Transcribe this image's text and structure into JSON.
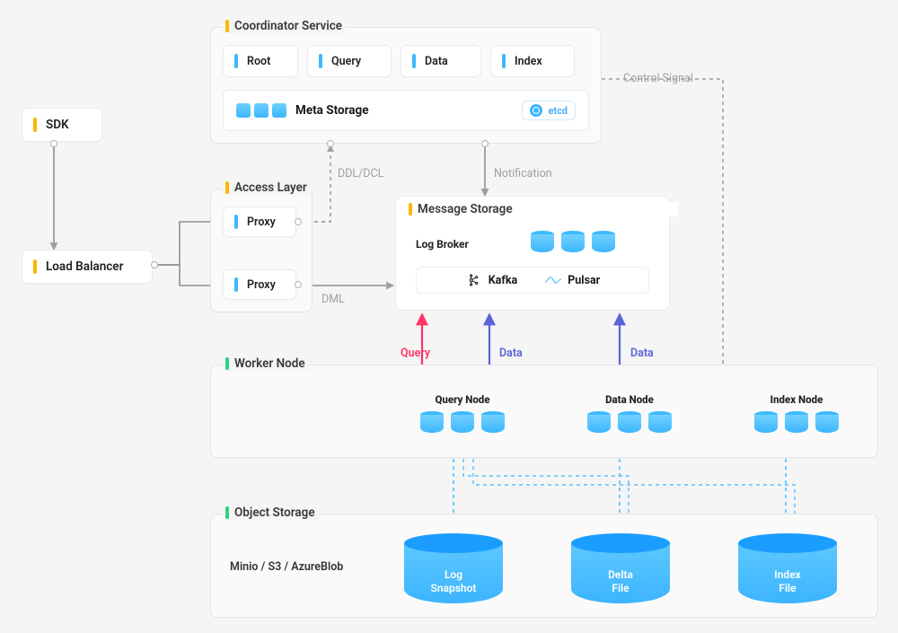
{
  "boxes": {
    "sdk": "SDK",
    "load_balancer": "Load Balancer"
  },
  "access_layer": {
    "title": "Access Layer",
    "proxy1": "Proxy",
    "proxy2": "Proxy"
  },
  "coordinator": {
    "title": "Coordinator Service",
    "root": "Root",
    "query": "Query",
    "data": "Data",
    "index": "Index",
    "meta": "Meta Storage",
    "etcd": "etcd"
  },
  "message_storage": {
    "title": "Message Storage",
    "log_broker": "Log Broker",
    "kafka": "Kafka",
    "pulsar": "Pulsar"
  },
  "worker_node": {
    "title": "Worker Node",
    "query_node": "Query Node",
    "data_node": "Data Node",
    "index_node": "Index Node"
  },
  "object_storage": {
    "title": "Object Storage",
    "providers": "Minio / S3 / AzureBlob",
    "log_snapshot": "Log\nSnapshot",
    "delta_file": "Delta\nFile",
    "index_file": "Index\nFile"
  },
  "labels": {
    "ddl_dcl": "DDL/DCL",
    "dml": "DML",
    "notification": "Notification",
    "control_signal": "Control Signal",
    "query": "Query",
    "data1": "Data",
    "data2": "Data"
  },
  "colors": {
    "accent_yellow": "#ffb600",
    "accent_green": "#2bd47a",
    "accent_blue": "#3ab6ff",
    "query_red": "#ff3366",
    "data_purple": "#5a63d8"
  }
}
